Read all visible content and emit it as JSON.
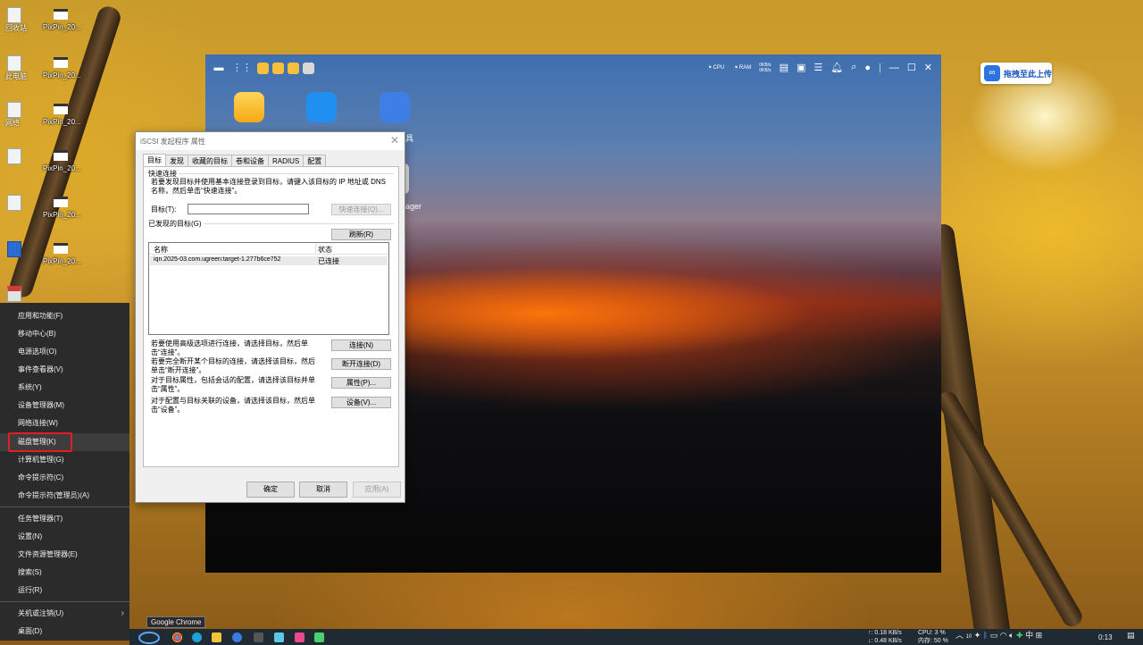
{
  "desktop": {
    "icons": [
      {
        "label_left": "回收站",
        "label": "PixPin_20..."
      },
      {
        "label_left": "此电脑",
        "label": "PixPin_20..."
      },
      {
        "label_left": "网络",
        "label": "PixPin_20..."
      },
      {
        "label_left": "",
        "label": "PixPin_20..."
      },
      {
        "label_left": "",
        "label": "PixPin_20..."
      },
      {
        "label_left": "",
        "label": "PixPin_20..."
      }
    ]
  },
  "nas": {
    "topbar_stats": {
      "cpu_label": "CPU",
      "ram_label": "RAM",
      "up": "0KB/s",
      "down": "0KB/s"
    },
    "app_partial_label": "ager",
    "app_partial_label2": "具"
  },
  "upload_badge": {
    "label": "拖拽至此上传"
  },
  "dialog": {
    "title": "iSCSI 发起程序 属性",
    "tabs": [
      "目标",
      "发现",
      "收藏的目标",
      "卷和设备",
      "RADIUS",
      "配置"
    ],
    "quick_connect": {
      "group_label": "快速连接",
      "description": "若要发现目标并使用基本连接登录到目标，请键入该目标的 IP 地址或 DNS 名称，然后单击“快速连接”。",
      "target_label": "目标(T):",
      "target_value": "",
      "quick_connect_button": "快速连接(Q)..."
    },
    "discovered": {
      "group_label": "已发现的目标(G)",
      "refresh_button": "刷新(R)",
      "columns": [
        "名称",
        "状态"
      ],
      "rows": [
        {
          "name": "iqn.2025-03.com.ugreen:target-1.277b6ce752",
          "status": "已连接"
        }
      ]
    },
    "actions": [
      {
        "text": "若要使用高级选项进行连接，请选择目标，然后单击“连接”。",
        "button": "连接(N)"
      },
      {
        "text": "若要完全断开某个目标的连接，请选择该目标，然后单击“断开连接”。",
        "button": "断开连接(D)"
      },
      {
        "text": "对于目标属性，包括会话的配置，请选择该目标并单击“属性”。",
        "button": "属性(P)..."
      },
      {
        "text": "对于配置与目标关联的设备，请选择该目标，然后单击“设备”。",
        "button": "设备(V)..."
      }
    ],
    "footer": {
      "ok": "确定",
      "cancel": "取消",
      "apply": "应用(A)"
    }
  },
  "context_menu": {
    "items_top": [
      "应用和功能(F)",
      "移动中心(B)",
      "电源选项(O)",
      "事件查看器(V)",
      "系统(Y)",
      "设备管理器(M)",
      "网络连接(W)",
      "磁盘管理(K)",
      "计算机管理(G)",
      "命令提示符(C)",
      "命令提示符(管理员)(A)"
    ],
    "items_mid": [
      "任务管理器(T)",
      "设置(N)",
      "文件资源管理器(E)",
      "搜索(S)",
      "运行(R)"
    ],
    "items_bottom": [
      "关机或注销(U)",
      "桌面(D)"
    ],
    "highlighted": "磁盘管理(K)"
  },
  "taskbar": {
    "tooltip": "Google Chrome",
    "net_up": "↑: 0.18 KB/s",
    "net_down": "↓: 0.48 KB/s",
    "cpu": "CPU: 3 %",
    "mem": "内存: 50 %",
    "temp": "10",
    "ime": "中",
    "time": "0:13"
  }
}
